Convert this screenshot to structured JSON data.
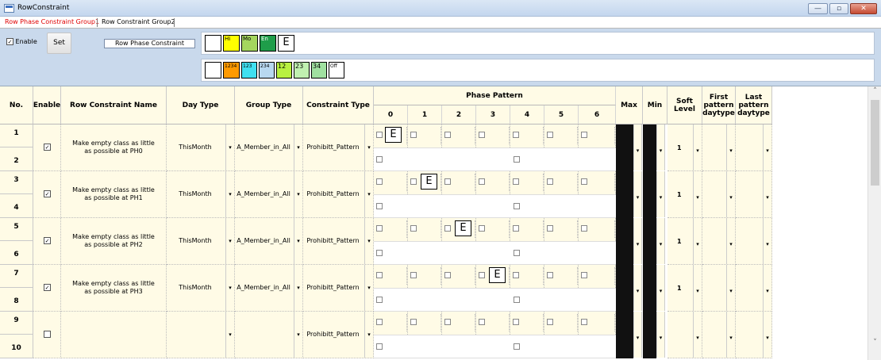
{
  "window": {
    "title": "RowConstraint",
    "min_glyph": "—",
    "max_glyph": "▫",
    "close_glyph": "✕"
  },
  "tabs": [
    {
      "label": "Row Phase Constraint Group1",
      "active": true
    },
    {
      "label": "Row Constraint Group2",
      "active": false
    }
  ],
  "toolbar": {
    "enable_label": "Enable",
    "enable_checked": "✓",
    "set_label": "Set",
    "mode_label": "Row Phase Constraint"
  },
  "palette_row1": [
    {
      "label": "",
      "color": "#ffffff"
    },
    {
      "label": "Hi",
      "color": "#ffff00"
    },
    {
      "label": "Mo",
      "color": "#a4d65e"
    },
    {
      "label": "En",
      "color": "#1f9d4a"
    },
    {
      "label": "E",
      "color": "#ffffff"
    }
  ],
  "palette_row2": [
    {
      "label": "",
      "color": "#ffffff"
    },
    {
      "label": "1234",
      "color": "#ff9a00"
    },
    {
      "label": "123",
      "color": "#40e0f0"
    },
    {
      "label": "234",
      "color": "#b8d8f0"
    },
    {
      "label": "12",
      "color": "#b8f040"
    },
    {
      "label": "23",
      "color": "#c0f0b0"
    },
    {
      "label": "34",
      "color": "#a0e0a0"
    },
    {
      "label": "Off",
      "color": "#ffffff"
    }
  ],
  "table": {
    "headers": {
      "no": "No.",
      "enable": "Enable",
      "name": "Row Constraint Name",
      "day_type": "Day Type",
      "group_type": "Group Type",
      "constraint_type": "Constraint Type",
      "phase_pattern": "Phase Pattern",
      "phases": [
        "0",
        "1",
        "2",
        "3",
        "4",
        "5",
        "6"
      ],
      "max": "Max",
      "min": "Min",
      "soft_level": "Soft Level",
      "first_daytype": "First pattern daytype",
      "last_daytype": "Last pattern daytype"
    },
    "dropdown_glyph": "▾",
    "rows": [
      {
        "nums": [
          "1",
          "2"
        ],
        "enabled": "✓",
        "name": "Make empty class as little as possible at PH0",
        "day_type": "ThisMonth",
        "group_type": "A_Member_in_All",
        "constraint_type": "Prohibitt_Pattern",
        "soft_level": "1",
        "e_phase": 0,
        "e_label": "E"
      },
      {
        "nums": [
          "3",
          "4"
        ],
        "enabled": "✓",
        "name": "Make empty class as little as possible at PH1",
        "day_type": "ThisMonth",
        "group_type": "A_Member_in_All",
        "constraint_type": "Prohibitt_Pattern",
        "soft_level": "1",
        "e_phase": 1,
        "e_label": "E"
      },
      {
        "nums": [
          "5",
          "6"
        ],
        "enabled": "✓",
        "name": "Make empty class as little as possible at PH2",
        "day_type": "ThisMonth",
        "group_type": "A_Member_in_All",
        "constraint_type": "Prohibitt_Pattern",
        "soft_level": "1",
        "e_phase": 2,
        "e_label": "E"
      },
      {
        "nums": [
          "7",
          "8"
        ],
        "enabled": "✓",
        "name": "Make empty class as little as possible at PH3",
        "day_type": "ThisMonth",
        "group_type": "A_Member_in_All",
        "constraint_type": "Prohibitt_Pattern",
        "soft_level": "1",
        "e_phase": 3,
        "e_label": "E"
      },
      {
        "nums": [
          "9",
          "10"
        ],
        "enabled": "",
        "name": "",
        "day_type": "",
        "group_type": "",
        "constraint_type": "Prohibitt_Pattern",
        "soft_level": "",
        "e_phase": null,
        "e_label": ""
      }
    ]
  },
  "scrollbar": {
    "up_glyph": "˄",
    "down_glyph": "˅"
  }
}
